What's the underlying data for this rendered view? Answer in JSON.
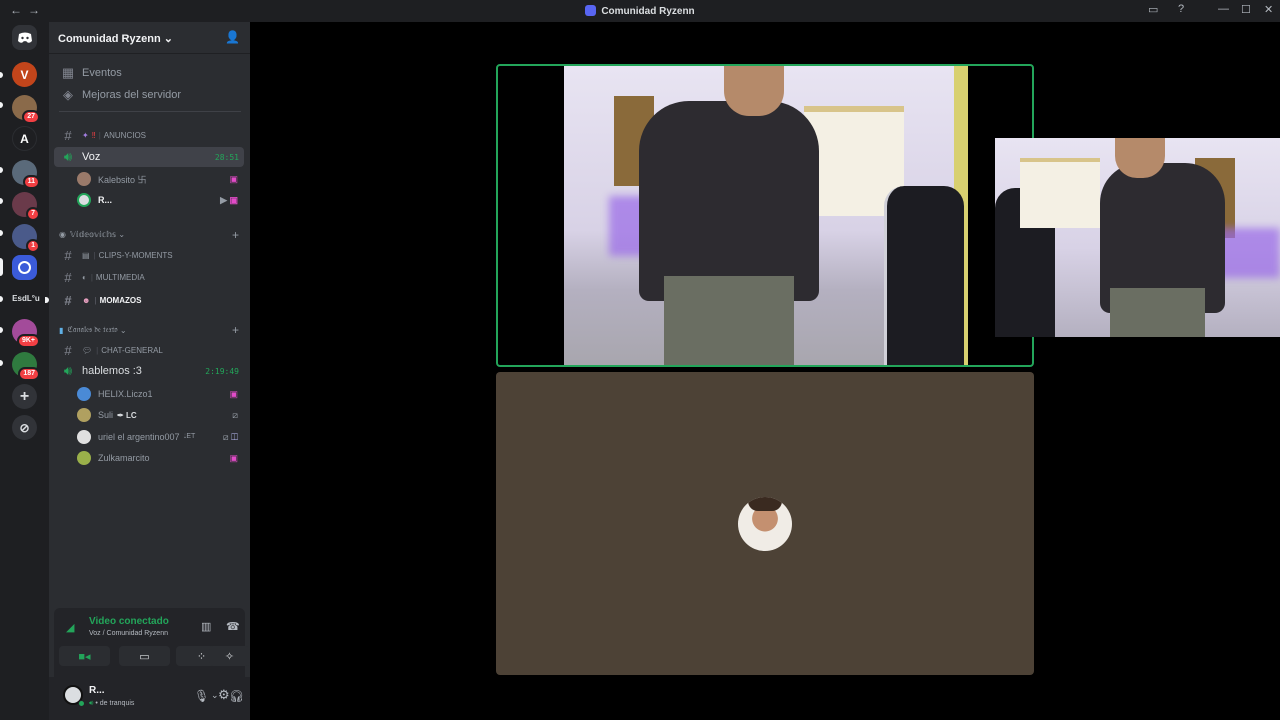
{
  "window": {
    "title": "Comunidad Ryzenn",
    "nav_back": "←",
    "nav_fwd": "→"
  },
  "servers": [
    {
      "name": "home-icon",
      "label": "",
      "badge": "",
      "color": "#313338"
    },
    {
      "name": "server-v",
      "label": "V",
      "badge": "",
      "color": "#c2451b"
    },
    {
      "name": "server-2",
      "label": "",
      "badge": "27",
      "color": "#8a6a4a"
    },
    {
      "name": "server-a",
      "label": "A",
      "badge": "",
      "color": "#1e1f22"
    },
    {
      "name": "server-4",
      "label": "",
      "badge": "11",
      "color": "#5a6a7a"
    },
    {
      "name": "server-5",
      "label": "",
      "badge": "7",
      "color": "#6a3a4a"
    },
    {
      "name": "server-6",
      "label": "",
      "badge": "1",
      "color": "#4a5a8a"
    },
    {
      "name": "server-7",
      "label": "",
      "badge": "",
      "color": "#3b5bd9"
    },
    {
      "name": "server-esdl",
      "label": "EsdL°u",
      "badge": "",
      "color": "#1e1f22"
    },
    {
      "name": "server-9",
      "label": "",
      "badge": "9K+",
      "color": "#a34b9a"
    },
    {
      "name": "server-10",
      "label": "",
      "badge": "187",
      "color": "#2f7a3f"
    }
  ],
  "guild": {
    "name": "Comunidad Ryzenn",
    "events": "Eventos",
    "boosts": "Mejoras del servidor",
    "channels": {
      "anuncios": "ANUNCIOS",
      "voz": "Voz",
      "voz_time": "28:51",
      "cat1": "𝕍𝕚𝕕𝕖𝕠𝕧𝕚𝕔𝕙𝕤",
      "clips": "CLIPS-Y-MOMENTS",
      "multimedia": "MULTIMEDIA",
      "momazos": "MOMAZOS",
      "cat2": "ℭ𝔞𝔫𝔞𝔩𝔢𝔰 𝔡𝔢 𝔱𝔢𝔵𝔱𝔬",
      "chat": "CHAT-GENERAL",
      "hablemos": "hablemos :3",
      "hablemos_time": "2:19:49"
    },
    "voz_users": [
      {
        "name": "Kalebsito 卐"
      },
      {
        "name": "R..."
      }
    ],
    "hablemos_users": [
      {
        "name": "HELIX.Liczo1"
      },
      {
        "name": "Suli"
      },
      {
        "name": "uriel el argentino007"
      },
      {
        "name": "Zulkamarcito"
      }
    ]
  },
  "voice": {
    "status": "Video conectado",
    "location": "Voz / Comunidad Ryzenn"
  },
  "me": {
    "name": "R...",
    "status": "de tranquis"
  },
  "suli_tag": "LC",
  "uriel_tag": "ET",
  "colors": {
    "accent": "#23a55a",
    "brand": "#5865f2",
    "badge": "#f23f43"
  }
}
